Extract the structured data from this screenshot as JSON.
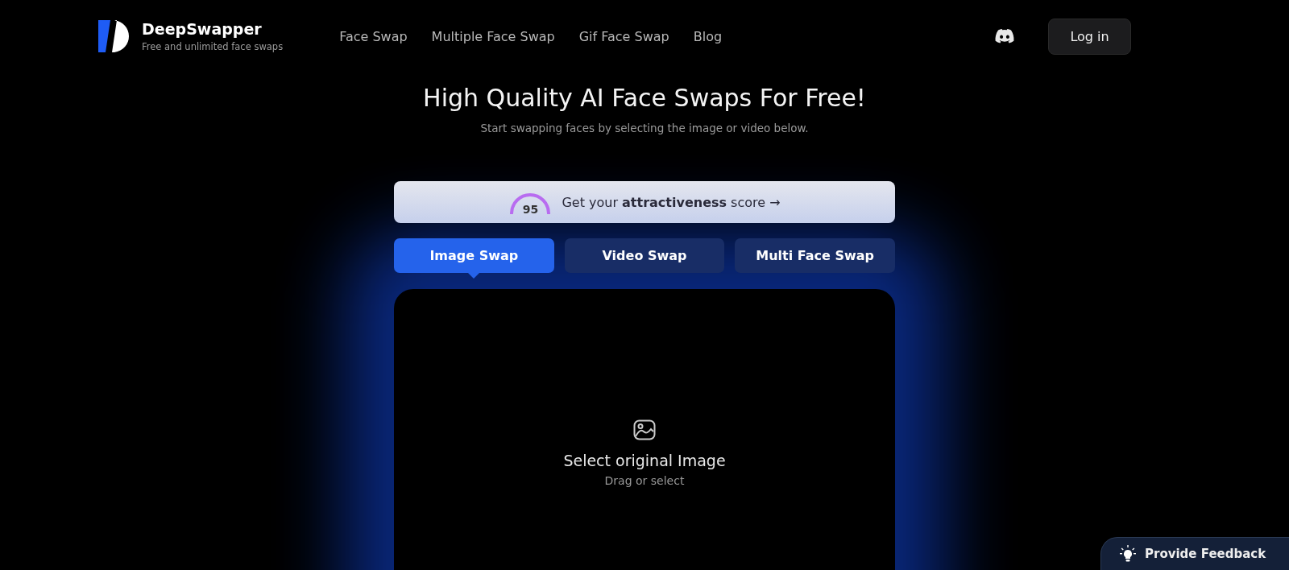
{
  "brand": {
    "name": "DeepSwapper",
    "tagline": "Free and unlimited face swaps"
  },
  "nav": [
    {
      "label": "Face Swap"
    },
    {
      "label": "Multiple Face Swap"
    },
    {
      "label": "Gif Face Swap"
    },
    {
      "label": "Blog"
    }
  ],
  "login_button": "Log in",
  "hero": {
    "title": "High Quality AI Face Swaps For Free!",
    "subtitle": "Start swapping faces by selecting the image or video below."
  },
  "score_banner": {
    "score": "95",
    "text": "Get your **attractiveness** score →"
  },
  "tabs": [
    {
      "label": "Image Swap",
      "selected": true
    },
    {
      "label": "Video Swap",
      "selected": false
    },
    {
      "label": "Multi Face Swap",
      "selected": false
    }
  ],
  "upload": {
    "title": "Select original Image",
    "hint": "Drag or select"
  },
  "feedback_button": "Provide Feedback"
}
